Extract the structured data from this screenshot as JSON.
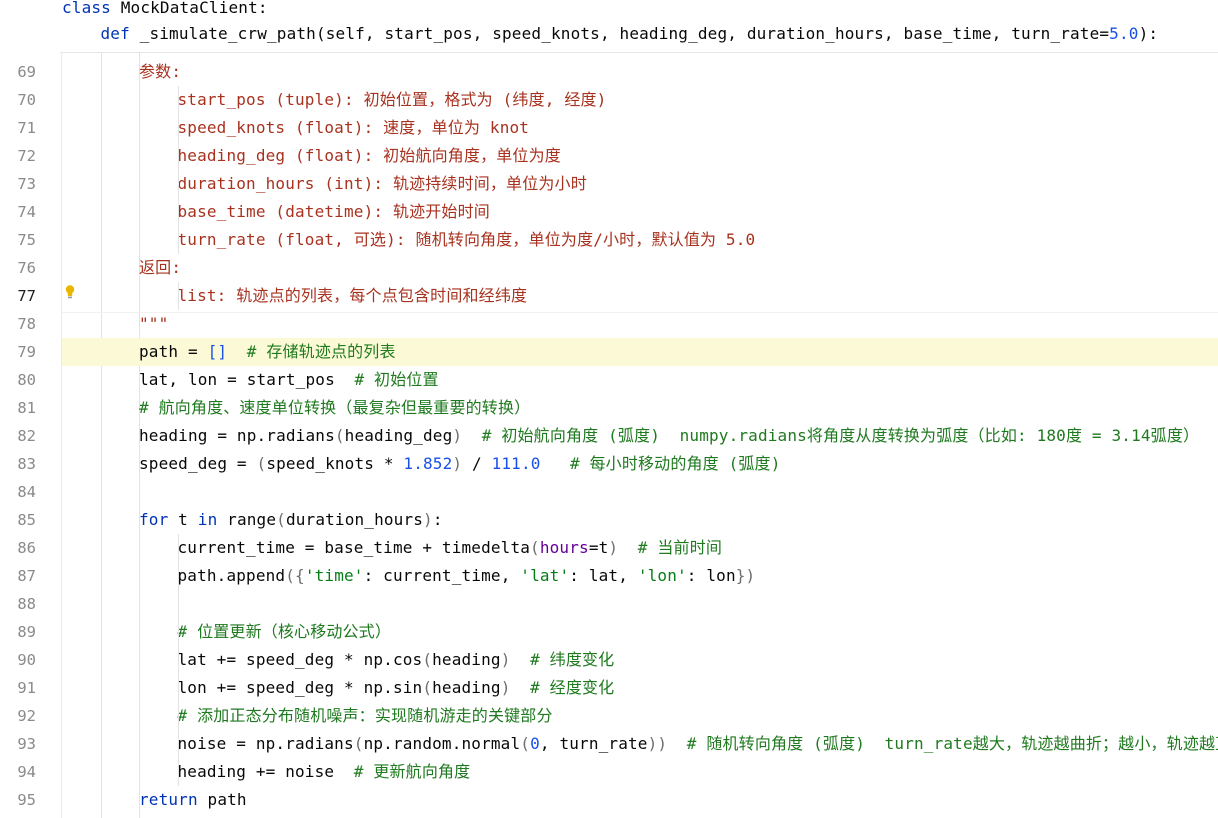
{
  "editor": {
    "sticky_lines": [
      {
        "indent": 0,
        "tokens": [
          [
            "kw",
            "class"
          ],
          [
            "t",
            " MockDataClient:"
          ]
        ]
      },
      {
        "indent": 1,
        "tokens": [
          [
            "kw",
            "def"
          ],
          [
            "t",
            " _simulate_crw_path(self, start_pos, speed_knots, heading_deg, duration_hours, base_time, turn_rate="
          ],
          [
            "num",
            "5.0"
          ],
          [
            "t",
            "):"
          ]
        ]
      }
    ],
    "current_line": 77,
    "highlighted_line": 79,
    "lines": [
      {
        "num": "69",
        "indent": 2,
        "tokens": [
          [
            "doc",
            "参数:"
          ]
        ]
      },
      {
        "num": "70",
        "indent": 3,
        "tokens": [
          [
            "doc",
            "start_pos (tuple): 初始位置，格式为 (纬度, 经度)"
          ]
        ]
      },
      {
        "num": "71",
        "indent": 3,
        "tokens": [
          [
            "doc",
            "speed_knots (float): 速度，单位为 knot"
          ]
        ]
      },
      {
        "num": "72",
        "indent": 3,
        "tokens": [
          [
            "doc",
            "heading_deg (float): 初始航向角度，单位为度"
          ]
        ]
      },
      {
        "num": "73",
        "indent": 3,
        "tokens": [
          [
            "doc",
            "duration_hours (int): 轨迹持续时间，单位为小时"
          ]
        ]
      },
      {
        "num": "74",
        "indent": 3,
        "tokens": [
          [
            "doc",
            "base_time (datetime): 轨迹开始时间"
          ]
        ]
      },
      {
        "num": "75",
        "indent": 3,
        "tokens": [
          [
            "doc",
            "turn_rate (float, 可选): 随机转向角度，单位为度/小时，默认值为 5.0"
          ]
        ]
      },
      {
        "num": "76",
        "indent": 2,
        "tokens": [
          [
            "doc",
            "返回:"
          ]
        ]
      },
      {
        "num": "77",
        "indent": 3,
        "tokens": [
          [
            "doc",
            "list: 轨迹点的列表，每个点包含时间和经纬度"
          ]
        ]
      },
      {
        "num": "78",
        "indent": 2,
        "tokens": [
          [
            "doc",
            "\"\"\""
          ]
        ]
      },
      {
        "num": "79",
        "indent": 2,
        "tokens": [
          [
            "t",
            "path = "
          ],
          [
            "num",
            "[]"
          ],
          [
            "t",
            "  "
          ],
          [
            "cmt",
            "# 存储轨迹点的列表"
          ]
        ]
      },
      {
        "num": "80",
        "indent": 2,
        "tokens": [
          [
            "t",
            "lat, lon = start_pos  "
          ],
          [
            "cmt",
            "# 初始位置"
          ]
        ]
      },
      {
        "num": "81",
        "indent": 2,
        "tokens": [
          [
            "cmt",
            "# 航向角度、速度单位转换（最复杂但最重要的转换）"
          ]
        ]
      },
      {
        "num": "82",
        "indent": 2,
        "tokens": [
          [
            "t",
            "heading = np.radians"
          ],
          [
            "bracket",
            "("
          ],
          [
            "t",
            "heading_deg"
          ],
          [
            "bracket",
            ")"
          ],
          [
            "t",
            "  "
          ],
          [
            "cmt",
            "# 初始航向角度 (弧度)  numpy.radians将角度从度转换为弧度（比如: 180度 = 3.14弧度）"
          ]
        ]
      },
      {
        "num": "83",
        "indent": 2,
        "tokens": [
          [
            "t",
            "speed_deg = "
          ],
          [
            "bracket",
            "("
          ],
          [
            "t",
            "speed_knots * "
          ],
          [
            "num",
            "1.852"
          ],
          [
            "bracket",
            ")"
          ],
          [
            "t",
            " / "
          ],
          [
            "num",
            "111.0"
          ],
          [
            "t",
            "   "
          ],
          [
            "cmt",
            "# 每小时移动的角度 (弧度)"
          ]
        ]
      },
      {
        "num": "84",
        "indent": 0,
        "tokens": []
      },
      {
        "num": "85",
        "indent": 2,
        "tokens": [
          [
            "kw",
            "for"
          ],
          [
            "t",
            " t "
          ],
          [
            "kw",
            "in"
          ],
          [
            "t",
            " range"
          ],
          [
            "bracket",
            "("
          ],
          [
            "t",
            "duration_hours"
          ],
          [
            "bracket",
            ")"
          ],
          [
            "t",
            ":"
          ]
        ]
      },
      {
        "num": "86",
        "indent": 3,
        "tokens": [
          [
            "t",
            "current_time = base_time + timedelta"
          ],
          [
            "bracket",
            "("
          ],
          [
            "param",
            "hours"
          ],
          [
            "t",
            "=t"
          ],
          [
            "bracket",
            ")"
          ],
          [
            "t",
            "  "
          ],
          [
            "cmt",
            "# 当前时间"
          ]
        ]
      },
      {
        "num": "87",
        "indent": 3,
        "tokens": [
          [
            "t",
            "path.append"
          ],
          [
            "bracket",
            "({"
          ],
          [
            "str",
            "'time'"
          ],
          [
            "t",
            ": current_time, "
          ],
          [
            "str",
            "'lat'"
          ],
          [
            "t",
            ": lat, "
          ],
          [
            "str",
            "'lon'"
          ],
          [
            "t",
            ": lon"
          ],
          [
            "bracket",
            "})"
          ]
        ]
      },
      {
        "num": "88",
        "indent": 0,
        "tokens": []
      },
      {
        "num": "89",
        "indent": 3,
        "tokens": [
          [
            "cmt",
            "# 位置更新（核心移动公式）"
          ]
        ]
      },
      {
        "num": "90",
        "indent": 3,
        "tokens": [
          [
            "t",
            "lat += speed_deg * np.cos"
          ],
          [
            "bracket",
            "("
          ],
          [
            "t",
            "heading"
          ],
          [
            "bracket",
            ")"
          ],
          [
            "t",
            "  "
          ],
          [
            "cmt",
            "# 纬度变化"
          ]
        ]
      },
      {
        "num": "91",
        "indent": 3,
        "tokens": [
          [
            "t",
            "lon += speed_deg * np.sin"
          ],
          [
            "bracket",
            "("
          ],
          [
            "t",
            "heading"
          ],
          [
            "bracket",
            ")"
          ],
          [
            "t",
            "  "
          ],
          [
            "cmt",
            "# 经度变化"
          ]
        ]
      },
      {
        "num": "92",
        "indent": 3,
        "tokens": [
          [
            "cmt",
            "# 添加正态分布随机噪声：实现随机游走的关键部分"
          ]
        ]
      },
      {
        "num": "93",
        "indent": 3,
        "tokens": [
          [
            "t",
            "noise = np.radians"
          ],
          [
            "bracket",
            "("
          ],
          [
            "t",
            "np.random.normal"
          ],
          [
            "bracket",
            "("
          ],
          [
            "num",
            "0"
          ],
          [
            "t",
            ", turn_rate"
          ],
          [
            "bracket",
            "))"
          ],
          [
            "t",
            "  "
          ],
          [
            "cmt",
            "# 随机转向角度 (弧度)  turn_rate越大，轨迹越曲折；越小，轨迹越直"
          ]
        ]
      },
      {
        "num": "94",
        "indent": 3,
        "tokens": [
          [
            "t",
            "heading += noise  "
          ],
          [
            "cmt",
            "# 更新航向角度"
          ]
        ]
      },
      {
        "num": "95",
        "indent": 2,
        "tokens": [
          [
            "kw",
            "return"
          ],
          [
            "t",
            " path"
          ]
        ]
      }
    ]
  }
}
